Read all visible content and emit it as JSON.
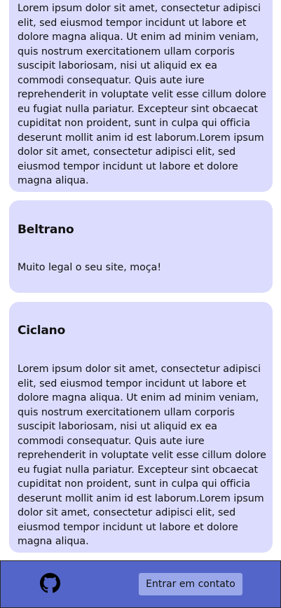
{
  "comments": [
    {
      "author": "",
      "text": "Lorem ipsum dolor sit amet, consectetur adipisci elit, sed eiusmod tempor incidunt ut labore et dolore magna aliqua. Ut enim ad minim veniam, quis nostrum exercitationem ullam corporis suscipit laboriosam, nisi ut aliquid ex ea commodi consequatur. Quis aute iure reprehenderit in voluptate velit esse cillum dolore eu fugiat nulla pariatur. Excepteur sint obcaecat cupiditat non proident, sunt in culpa qui officia deserunt mollit anim id est laborum.Lorem ipsum dolor sit amet, consectetur adipisci elit, sed eiusmod tempor incidunt ut labore et dolore magna aliqua."
    },
    {
      "author": "Beltrano",
      "text": "Muito legal o seu site, moça!"
    },
    {
      "author": "Ciclano",
      "text": "Lorem ipsum dolor sit amet, consectetur adipisci elit, sed eiusmod tempor incidunt ut labore et dolore magna aliqua. Ut enim ad minim veniam, quis nostrum exercitationem ullam corporis suscipit laboriosam, nisi ut aliquid ex ea commodi consequatur. Quis aute iure reprehenderit in voluptate velit esse cillum dolore eu fugiat nulla pariatur. Excepteur sint obcaecat cupiditat non proident, sunt in culpa qui officia deserunt mollit anim id est laborum.Lorem ipsum dolor sit amet, consectetur adipisci elit, sed eiusmod tempor incidunt ut labore et dolore magna aliqua."
    }
  ],
  "footer": {
    "github_icon": "github-icon",
    "contact_button_label": "Entrar em contato"
  },
  "colors": {
    "card_background": "#dcdcfe",
    "footer_background": "#5365c8",
    "button_background": "#9aa8ea",
    "text": "#111111"
  }
}
